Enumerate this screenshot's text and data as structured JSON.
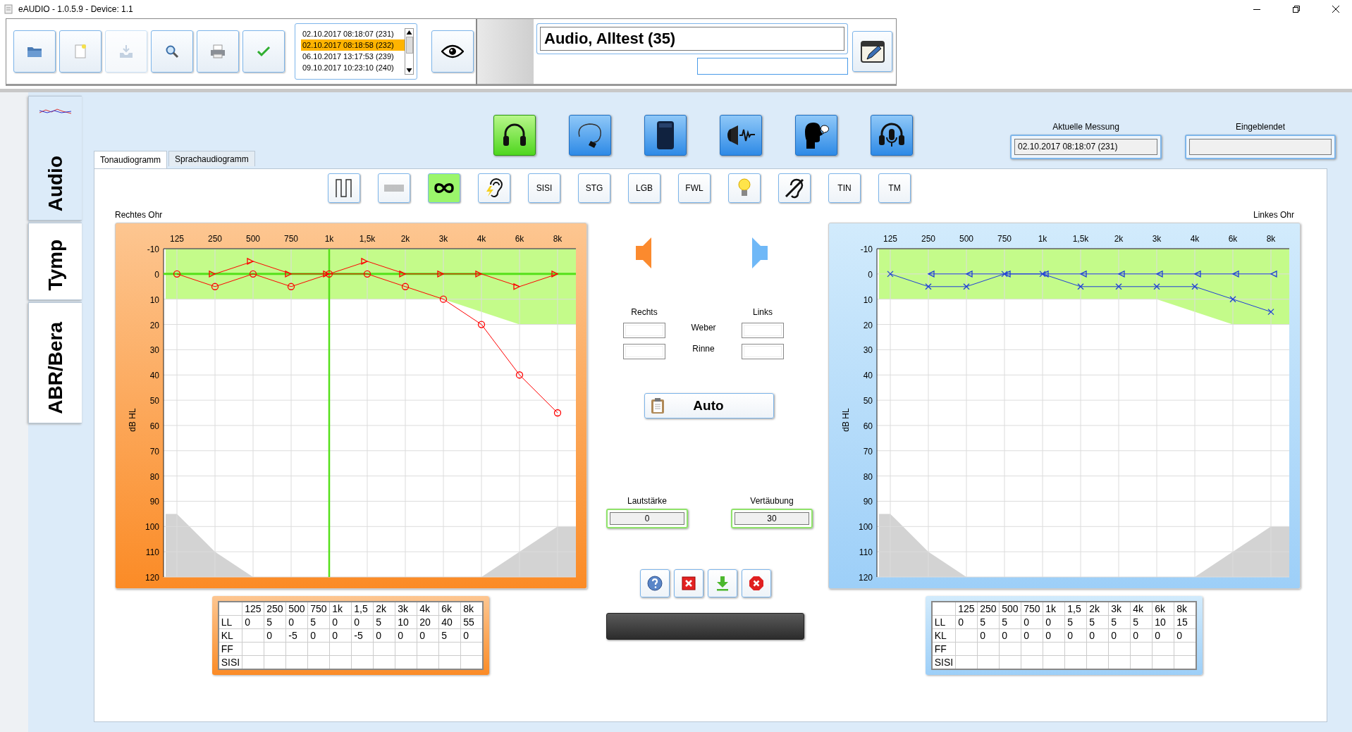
{
  "window": {
    "title": "eAUDIO - 1.0.5.9 - Device: 1.1"
  },
  "toolbar": {
    "buttons": [
      {
        "disabled": false
      },
      {
        "disabled": false
      },
      {
        "disabled": true
      },
      {
        "disabled": false
      },
      {
        "disabled": false
      },
      {
        "disabled": false
      }
    ],
    "measurements": [
      {
        "label": "02.10.2017 08:18:07 (231)",
        "selected": false
      },
      {
        "label": "02.10.2017 08:18:58 (232)",
        "selected": true
      },
      {
        "label": "06.10.2017 13:17:53 (239)",
        "selected": false
      },
      {
        "label": "09.10.2017 10:23:10 (240)",
        "selected": false
      }
    ]
  },
  "patient": {
    "name": "Audio, Alltest (35)"
  },
  "sidebar": {
    "tabs": [
      {
        "label": "Audio",
        "selected": true
      },
      {
        "label": "Tymp",
        "selected": false
      },
      {
        "label": "ABR/Bera",
        "selected": false
      }
    ]
  },
  "modes": [
    {
      "selected": true
    },
    {
      "selected": false
    },
    {
      "selected": false
    },
    {
      "selected": false
    },
    {
      "selected": false
    },
    {
      "selected": false
    }
  ],
  "current_measurement": {
    "label": "Aktuelle Messung",
    "value": "02.10.2017 08:18:07 (231)"
  },
  "overlay": {
    "label": "Eingeblendet"
  },
  "tabs": [
    {
      "label": "Tonaudiogramm",
      "selected": true
    },
    {
      "label": "Sprachaudiogramm",
      "selected": false
    }
  ],
  "tools": [
    {
      "selected": false
    },
    {
      "selected": false
    },
    {
      "selected": true
    },
    {
      "selected": false
    },
    {
      "label": "SISI",
      "selected": false
    },
    {
      "label": "STG",
      "selected": false
    },
    {
      "label": "LGB",
      "selected": false
    },
    {
      "label": "FWL",
      "selected": false
    },
    {
      "selected": false
    },
    {
      "selected": false
    },
    {
      "label": "TIN",
      "selected": false
    },
    {
      "label": "TM",
      "selected": false
    }
  ],
  "audiograms": [
    {
      "kind": "right",
      "label": "Rechtes Ohr",
      "chart_data": {
        "type": "line",
        "ylabel": "dB HL",
        "categories": [
          "125",
          "250",
          "500",
          "750",
          "1k",
          "1,5k",
          "2k",
          "3k",
          "4k",
          "6k",
          "8k"
        ],
        "yticks": [
          -10,
          0,
          10,
          20,
          30,
          40,
          50,
          60,
          70,
          80,
          90,
          100,
          110,
          120
        ],
        "ylim": [
          120,
          -10
        ],
        "grid": true,
        "ref_lines": [
          {
            "axis": "x",
            "value": "1k",
            "color": "#55e01a"
          },
          {
            "axis": "y",
            "value": 0,
            "color": "#55e01a"
          }
        ],
        "series": [
          {
            "color": "#ff0000",
            "marker": "circle",
            "values": [
              0,
              5,
              0,
              5,
              0,
              0,
              5,
              10,
              20,
              40,
              55
            ]
          },
          {
            "color": "#ff0000",
            "marker": "triangle",
            "values": [
              null,
              0,
              -5,
              0,
              0,
              -5,
              0,
              0,
              0,
              5,
              0
            ]
          }
        ]
      },
      "table": {
        "columns": [
          "125",
          "250",
          "500",
          "750",
          "1k",
          "1,5",
          "2k",
          "3k",
          "4k",
          "6k",
          "8k"
        ],
        "rows": [
          {
            "label": "LL",
            "cells": [
              "0",
              "5",
              "0",
              "5",
              "0",
              "0",
              "5",
              "10",
              "20",
              "40",
              "55"
            ]
          },
          {
            "label": "KL",
            "cells": [
              null,
              "0",
              "-5",
              "0",
              "0",
              "-5",
              "0",
              "0",
              "0",
              "5",
              "0"
            ]
          },
          {
            "label": "FF"
          },
          {
            "label": "SISI"
          }
        ]
      }
    },
    {
      "kind": "left",
      "label": "Linkes Ohr",
      "chart_data": {
        "type": "line",
        "ylabel": "dB HL",
        "categories": [
          "125",
          "250",
          "500",
          "750",
          "1k",
          "1,5k",
          "2k",
          "3k",
          "4k",
          "6k",
          "8k"
        ],
        "yticks": [
          -10,
          0,
          10,
          20,
          30,
          40,
          50,
          60,
          70,
          80,
          90,
          100,
          110,
          120
        ],
        "ylim": [
          120,
          -10
        ],
        "grid": true,
        "series": [
          {
            "color": "#1f3fd8",
            "marker": "cross",
            "values": [
              0,
              5,
              5,
              0,
              0,
              5,
              5,
              5,
              5,
              10,
              15
            ]
          },
          {
            "color": "#1f3fd8",
            "marker": "triangle",
            "values": [
              null,
              0,
              0,
              0,
              0,
              0,
              0,
              0,
              0,
              0,
              0
            ]
          }
        ]
      },
      "table": {
        "columns": [
          "125",
          "250",
          "500",
          "750",
          "1k",
          "1,5",
          "2k",
          "3k",
          "4k",
          "6k",
          "8k"
        ],
        "rows": [
          {
            "label": "LL",
            "cells": [
              "0",
              "5",
              "5",
              "0",
              "0",
              "5",
              "5",
              "5",
              "5",
              "10",
              "15"
            ]
          },
          {
            "label": "KL",
            "cells": [
              null,
              "0",
              "0",
              "0",
              "0",
              "0",
              "0",
              "0",
              "0",
              "0",
              "0"
            ]
          },
          {
            "label": "FF"
          },
          {
            "label": "SISI"
          }
        ]
      }
    }
  ],
  "tests": {
    "right_label": "Rechts",
    "left_label": "Links",
    "rows": [
      {
        "label": "Weber"
      },
      {
        "label": "Rinne"
      }
    ]
  },
  "auto_button": {
    "label": "Auto"
  },
  "volume": {
    "label": "Lautstärke",
    "value": "0"
  },
  "masking": {
    "label": "Vertäubung",
    "value": "30"
  }
}
